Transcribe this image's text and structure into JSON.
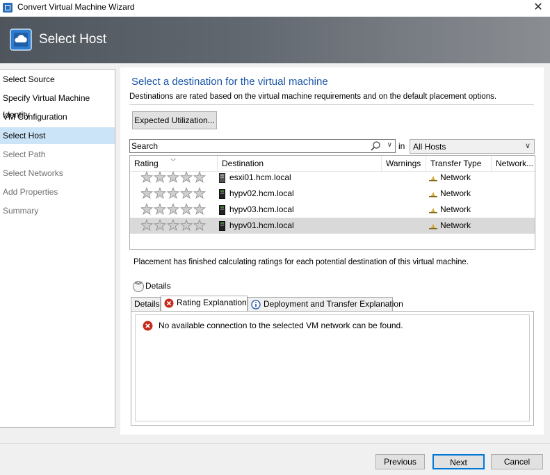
{
  "window": {
    "title": "Convert Virtual Machine Wizard",
    "close_glyph": "✕"
  },
  "banner": {
    "title": "Select Host",
    "icon": "cloud-vm-icon"
  },
  "sidebar": {
    "items": [
      {
        "label": "Select Source",
        "state": "done"
      },
      {
        "label": "Specify Virtual Machine Identity",
        "state": "done"
      },
      {
        "label": "VM Configuration",
        "state": "done"
      },
      {
        "label": "Select Host",
        "state": "selected"
      },
      {
        "label": "Select Path",
        "state": "disabled"
      },
      {
        "label": "Select Networks",
        "state": "disabled"
      },
      {
        "label": "Add Properties",
        "state": "disabled"
      },
      {
        "label": "Summary",
        "state": "disabled"
      }
    ]
  },
  "main": {
    "heading": "Select a destination for the virtual machine",
    "subtext": "Destinations are rated based on the virtual machine requirements and on the default placement options.",
    "expected_button": "Expected Utilization...",
    "search": {
      "placeholder": "Search",
      "in_label": "in",
      "scope_value": "All Hosts"
    },
    "grid": {
      "columns": [
        "Rating",
        "Destination",
        "Warnings",
        "Transfer Type",
        "Network..."
      ],
      "rows": [
        {
          "rating": 0,
          "destination": "esxi01.hcm.local",
          "warnings": "",
          "transfer_type": "Network",
          "network": "",
          "selected": false
        },
        {
          "rating": 0,
          "destination": "hypv02.hcm.local",
          "warnings": "",
          "transfer_type": "Network",
          "network": "",
          "selected": false
        },
        {
          "rating": 0,
          "destination": "hypv03.hcm.local",
          "warnings": "",
          "transfer_type": "Network",
          "network": "",
          "selected": false
        },
        {
          "rating": 0,
          "destination": "hypv01.hcm.local",
          "warnings": "",
          "transfer_type": "Network",
          "network": "",
          "selected": true
        }
      ]
    },
    "placement_text": "Placement has finished calculating ratings for each potential destination of this virtual machine.",
    "details_label": "Details",
    "tabs": [
      {
        "label": "Details"
      },
      {
        "label": "Rating Explanation",
        "icon": "error-icon"
      },
      {
        "label": "Deployment and Transfer Explanation",
        "icon": "info-icon"
      }
    ],
    "active_tab": 1,
    "message": "No available connection to the selected VM network can be found."
  },
  "footer": {
    "previous": "Previous",
    "next": "Next",
    "cancel": "Cancel"
  },
  "colors": {
    "accent": "#1a55a8",
    "selection": "#cce4f7",
    "row_selected": "#d9d9d9",
    "error": "#c42b1c"
  }
}
